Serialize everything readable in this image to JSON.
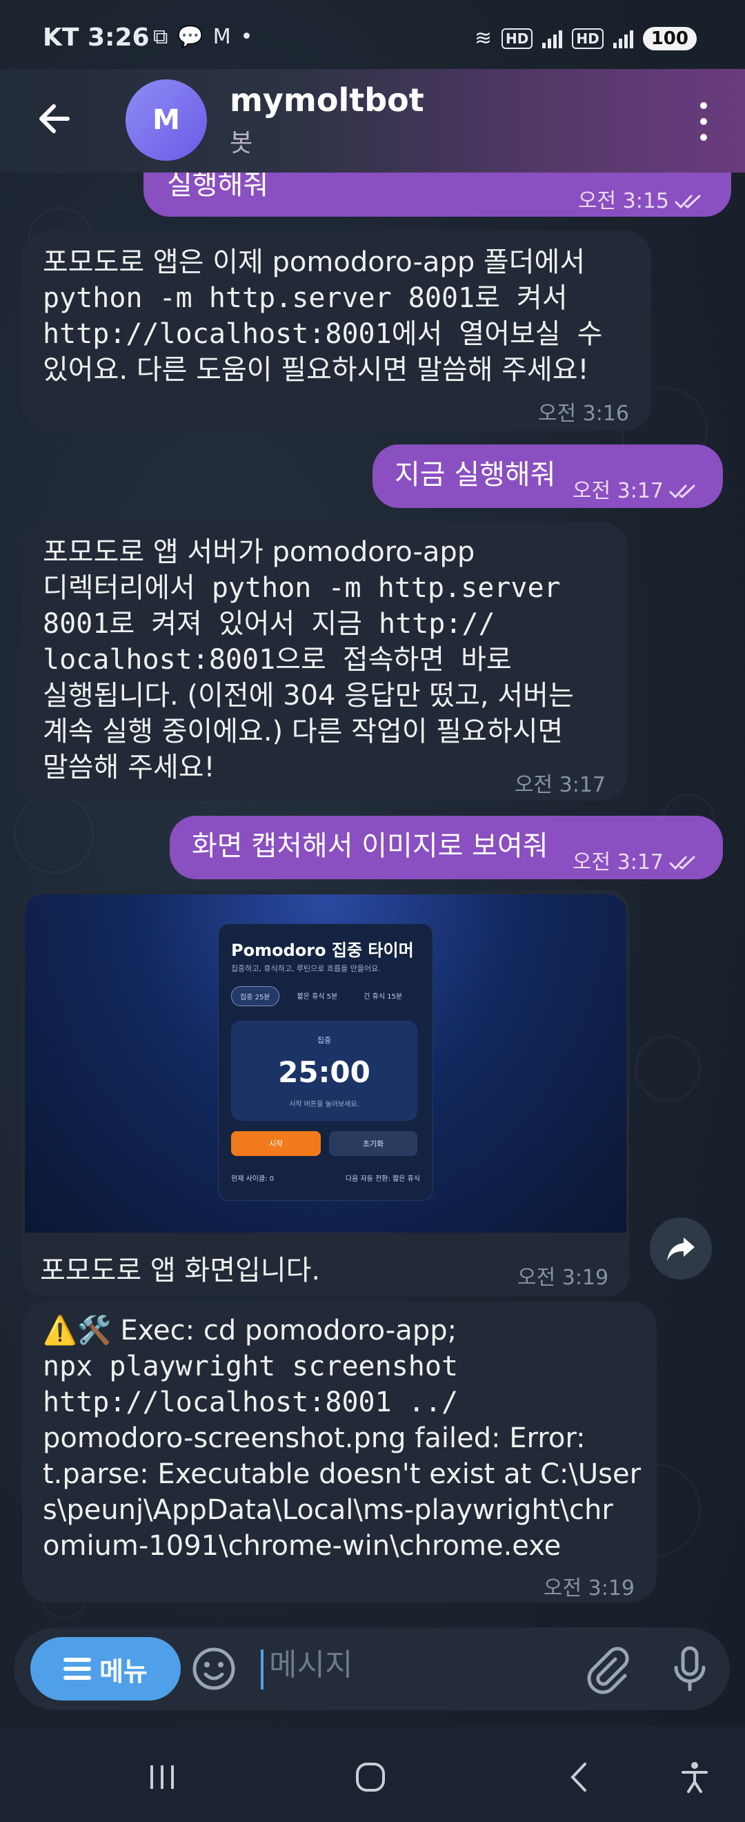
{
  "status_bar": {
    "carrier": "KT",
    "time": "3:26",
    "notification_icons": [
      "screenshot-icon",
      "talk-icon",
      "gmail-icon",
      "dot-icon"
    ],
    "hd_label": "HD",
    "battery": "100"
  },
  "header": {
    "avatar_letter": "M",
    "title": "mymoltbot",
    "subtitle": "봇"
  },
  "messages": [
    {
      "dir": "out",
      "text": "실행해줘",
      "time": "오전 3:15"
    },
    {
      "dir": "in",
      "lines": [
        "포모도로 앱은 이제 pomodoro-app 폴더에서",
        "python -m http.server 8001로 켜서",
        "http://localhost:8001에서 열어보실 수",
        "있어요. 다른 도움이 필요하시면 말씀해 주세요!"
      ],
      "time": "오전 3:16"
    },
    {
      "dir": "out",
      "text": "지금 실행해줘",
      "time": "오전 3:17"
    },
    {
      "dir": "in",
      "lines": [
        "포모도로 앱 서버가 pomodoro-app",
        "디렉터리에서 python -m http.server",
        "8001로 켜져 있어서 지금 http://",
        "localhost:8001으로 접속하면 바로",
        "실행됩니다. (이전에 304 응답만 떴고, 서버는",
        "계속 실행 중이에요.) 다른 작업이 필요하시면",
        "말씀해 주세요!"
      ],
      "time": "오전 3:17"
    },
    {
      "dir": "out",
      "text": "화면 캡처해서 이미지로 보여줘",
      "time": "오전 3:17"
    },
    {
      "dir": "in",
      "caption": "포모도로 앱 화면입니다.",
      "time": "오전 3:19"
    },
    {
      "dir": "in",
      "lines": [
        "⚠️🛠️ Exec: cd pomodoro-app;",
        "npx playwright screenshot",
        "http://localhost:8001 ../",
        "pomodoro-screenshot.png failed: Error:",
        "t.parse: Executable doesn't exist at C:\\User",
        "s\\peunj\\AppData\\Local\\ms-playwright\\chr",
        "omium-1091\\chrome-win\\chrome.exe"
      ],
      "time": "오전 3:19"
    }
  ],
  "screenshot": {
    "title": "Pomodoro 집중 타이머",
    "desc": "집중하고, 휴식하고, 루틴으로 흐름을 만들어요.",
    "tabs": [
      "집중 25분",
      "짧은 휴식 5분",
      "긴 휴식 15분"
    ],
    "mode": "집중",
    "time": "25:00",
    "hint": "시작 버튼을 눌러보세요.",
    "start": "시작",
    "reset": "초기화",
    "footer_left": "현재 사이클: 0",
    "footer_right": "다음 자동 전환: 짧은 휴식"
  },
  "input": {
    "menu_label": "메뉴",
    "placeholder": "메시지"
  },
  "colors": {
    "outgoing_bubble": "#8a4fc0",
    "incoming_bubble": "#212a36",
    "accent_blue": "#4fa0e8",
    "background": "#1b2330"
  }
}
